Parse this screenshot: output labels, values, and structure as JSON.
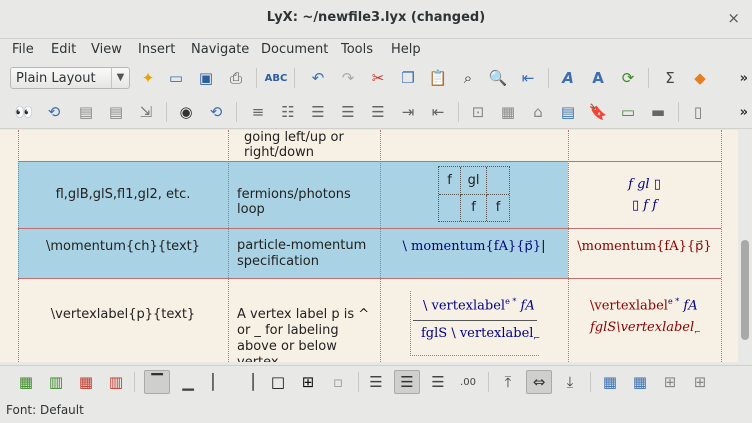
{
  "window": {
    "title": "LyX: ~/newfile3.lyx (changed)",
    "close_symbol": "×"
  },
  "menu": [
    "File",
    "Edit",
    "View",
    "Insert",
    "Navigate",
    "Document",
    "Tools",
    "Help"
  ],
  "toolbar": {
    "layout_value": "Plain Layout",
    "more": "»"
  },
  "table": {
    "partial_row": {
      "desc_line1": "going left/up or",
      "desc_line2": "right/down"
    },
    "row1": {
      "command": "fl,glB,glS,fl1,gl2, etc.",
      "desc": "fermions/photons loop",
      "grid": [
        "f",
        "gl",
        "",
        "",
        "f",
        "f"
      ],
      "preview_line1": "f  gl  ▯",
      "preview_line2": "▯  f  f"
    },
    "row2": {
      "command": "\\momentum{ch}{text}",
      "desc_line1": "particle-momentum",
      "desc_line2": "specification",
      "math": "\\ momentum{fA}{p⃗}",
      "preview": "\\momentum{fA}{p⃗}"
    },
    "row3": {
      "command": "\\vertexlabel{p}{text}",
      "desc_line1": "A vertex label p is ^",
      "desc_line2": "or _ for labeling",
      "desc_line3": "above or below vertex",
      "math_top": "\\ vertexlabel",
      "math_top_sup": "e *",
      "math_top_arg": "fA",
      "math_bottom": "fglS \\ vertexlabel",
      "math_bottom_sub": "⌐",
      "preview_top": "\\vertexlabel",
      "preview_top_sup": "e *",
      "preview_top_arg": "fA",
      "preview_bottom": "fglS\\vertexlabel",
      "preview_bottom_sub": "⌐"
    }
  },
  "status": {
    "text": "Font: Default"
  }
}
